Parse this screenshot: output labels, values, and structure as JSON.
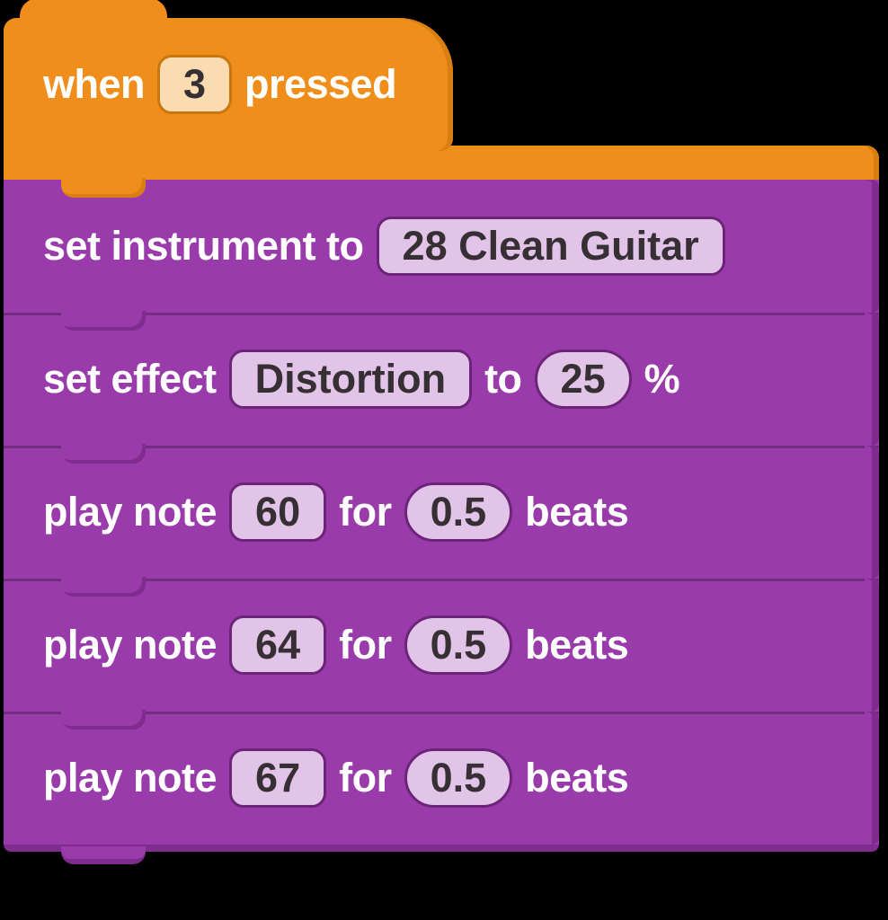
{
  "hat": {
    "prefix": "when",
    "key": "3",
    "suffix": "pressed"
  },
  "blocks": [
    {
      "type": "set_instrument",
      "label_before": "set instrument to",
      "instrument": "28 Clean Guitar"
    },
    {
      "type": "set_effect",
      "label_before": "set effect",
      "effect": "Distortion",
      "label_mid": "to",
      "value": "25",
      "label_after": "%"
    },
    {
      "type": "play_note",
      "label_before": "play note",
      "note": "60",
      "label_mid": "for",
      "beats": "0.5",
      "label_after": "beats"
    },
    {
      "type": "play_note",
      "label_before": "play note",
      "note": "64",
      "label_mid": "for",
      "beats": "0.5",
      "label_after": "beats"
    },
    {
      "type": "play_note",
      "label_before": "play note",
      "note": "67",
      "label_mid": "for",
      "beats": "0.5",
      "label_after": "beats"
    }
  ]
}
